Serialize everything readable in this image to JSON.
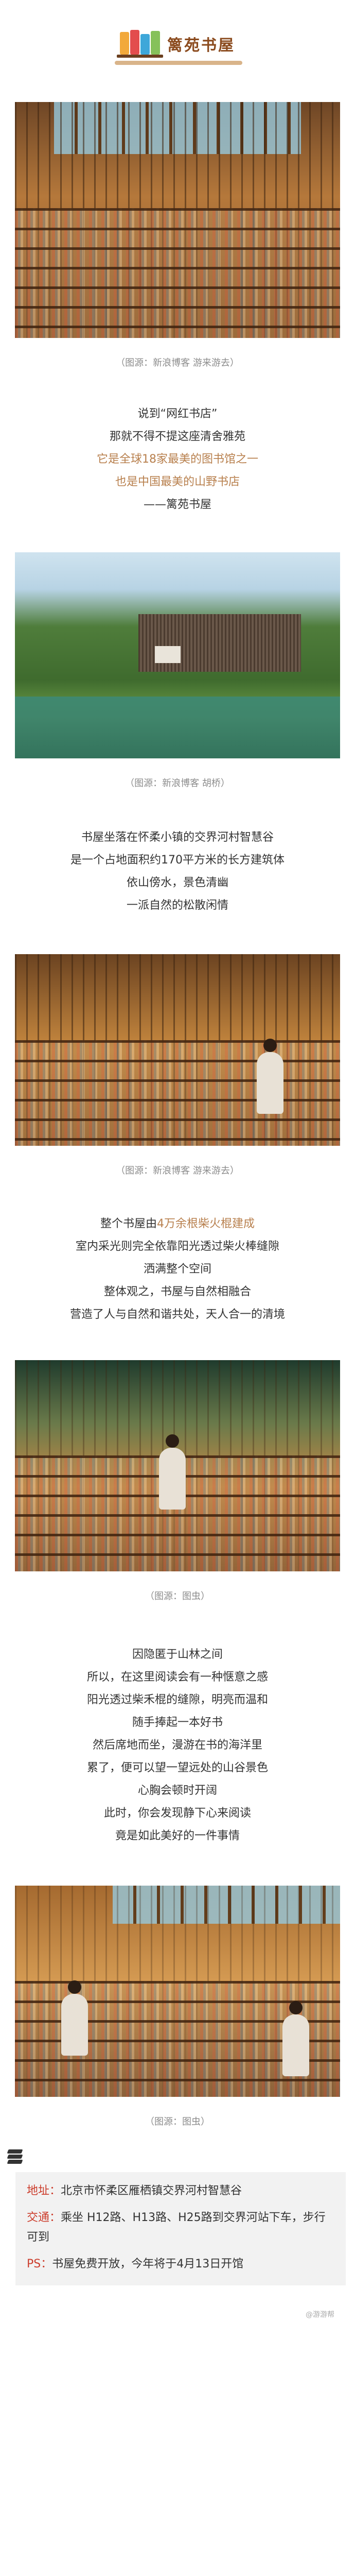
{
  "header": {
    "title": "篱苑书屋"
  },
  "captions": {
    "c1": "（图源：新浪博客 游来游去）",
    "c2": "（图源：新浪博客 胡桥）",
    "c3": "（图源：新浪博客 游来游去）",
    "c4": "（图源：图虫）",
    "c5": "（图源：图虫）"
  },
  "intro": {
    "l1": "说到“网红书店”",
    "l2": "那就不得不提这座清舍雅苑",
    "l3": "它是全球18家最美的图书馆之一",
    "l4": "也是中国最美的山野书店",
    "l5": "——篱苑书屋"
  },
  "location": {
    "l1": "书屋坐落在怀柔小镇的交界河村智慧谷",
    "l2": "是一个占地面积约170平方米的长方建筑体",
    "l3": "依山傍水，景色清幽",
    "l4": "一派自然的松散闲情"
  },
  "structure": {
    "l1a": "整个书屋由",
    "l1b": "4万余根柴火棍建成",
    "l2": "室内采光则完全依靠阳光透过柴火棒缝隙",
    "l3": "洒满整个空间",
    "l4": "整体观之，书屋与自然相融合",
    "l5": "营造了人与自然和谐共处，天人合一的清境"
  },
  "reading": {
    "l1": "因隐匿于山林之间",
    "l2": "所以，在这里阅读会有一种惬意之感",
    "l3": "阳光透过柴禾棍的缝隙，明亮而温和",
    "l4": "随手捧起一本好书",
    "l5": "然后席地而坐，漫游在书的海洋里",
    "l6": "累了，便可以望一望远处的山谷景色",
    "l7": "心胸会顿时开阔",
    "l8": "此时，你会发现静下心来阅读",
    "l9": "竟是如此美好的一件事情"
  },
  "info": {
    "address_label": "地址：",
    "address_value": "北京市怀柔区雁栖镇交界河村智慧谷",
    "transport_label": "交通：",
    "transport_value": "乘坐 H12路、H13路、H25路到交界河站下车，步行可到",
    "ps_label": "PS：",
    "ps_value": "书屋免费开放，今年将于4月13日开馆"
  },
  "footer": {
    "watermark": "@游游帮"
  },
  "icons": {
    "logo": "bookshelf-logo-icon",
    "info": "stack-layers-icon"
  },
  "colors": {
    "title": "#8b4b1e",
    "accent": "#b8804e",
    "label": "#cc3d2c",
    "caption": "#8c8c8c"
  }
}
